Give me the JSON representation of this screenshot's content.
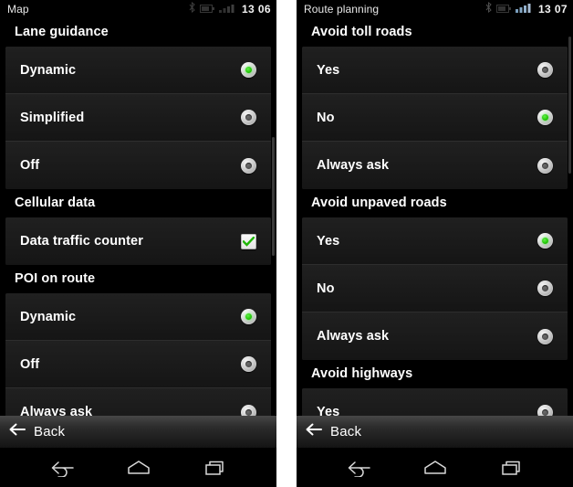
{
  "panels": [
    {
      "status": {
        "title": "Map",
        "time": "13 06"
      },
      "sections": [
        {
          "header": "Lane guidance",
          "rows": [
            {
              "label": "Dynamic",
              "control": "radio",
              "selected": true
            },
            {
              "label": "Simplified",
              "control": "radio",
              "selected": false
            },
            {
              "label": "Off",
              "control": "radio",
              "selected": false
            }
          ]
        },
        {
          "header": "Cellular data",
          "rows": [
            {
              "label": "Data traffic counter",
              "control": "checkbox",
              "selected": true
            }
          ]
        },
        {
          "header": "POI on route",
          "rows": [
            {
              "label": "Dynamic",
              "control": "radio",
              "selected": true
            },
            {
              "label": "Off",
              "control": "radio",
              "selected": false
            },
            {
              "label": "Always ask",
              "control": "radio",
              "selected": false
            }
          ]
        }
      ],
      "backbar": {
        "label": "Back",
        "icon": "arrow-left-icon"
      }
    },
    {
      "status": {
        "title": "Route planning",
        "time": "13 07"
      },
      "sections": [
        {
          "header": "Avoid toll roads",
          "rows": [
            {
              "label": "Yes",
              "control": "radio",
              "selected": false
            },
            {
              "label": "No",
              "control": "radio",
              "selected": true
            },
            {
              "label": "Always ask",
              "control": "radio",
              "selected": false
            }
          ]
        },
        {
          "header": "Avoid unpaved roads",
          "rows": [
            {
              "label": "Yes",
              "control": "radio",
              "selected": true
            },
            {
              "label": "No",
              "control": "radio",
              "selected": false
            },
            {
              "label": "Always ask",
              "control": "radio",
              "selected": false
            }
          ]
        },
        {
          "header": "Avoid  highways",
          "rows": [
            {
              "label": "Yes",
              "control": "radio",
              "selected": false
            }
          ]
        }
      ],
      "backbar": {
        "label": "Back",
        "icon": "arrow-left-icon"
      }
    }
  ],
  "navbar": {
    "back": "navigation-back-icon",
    "home": "navigation-home-icon",
    "recents": "navigation-recents-icon"
  },
  "status_icons": [
    "bluetooth-icon",
    "battery-icon",
    "signal-bars-icon"
  ],
  "colors": {
    "accent_green": "#22c806",
    "background": "#000000",
    "row_background": "#1b1b1b",
    "text": "#ffffff"
  }
}
